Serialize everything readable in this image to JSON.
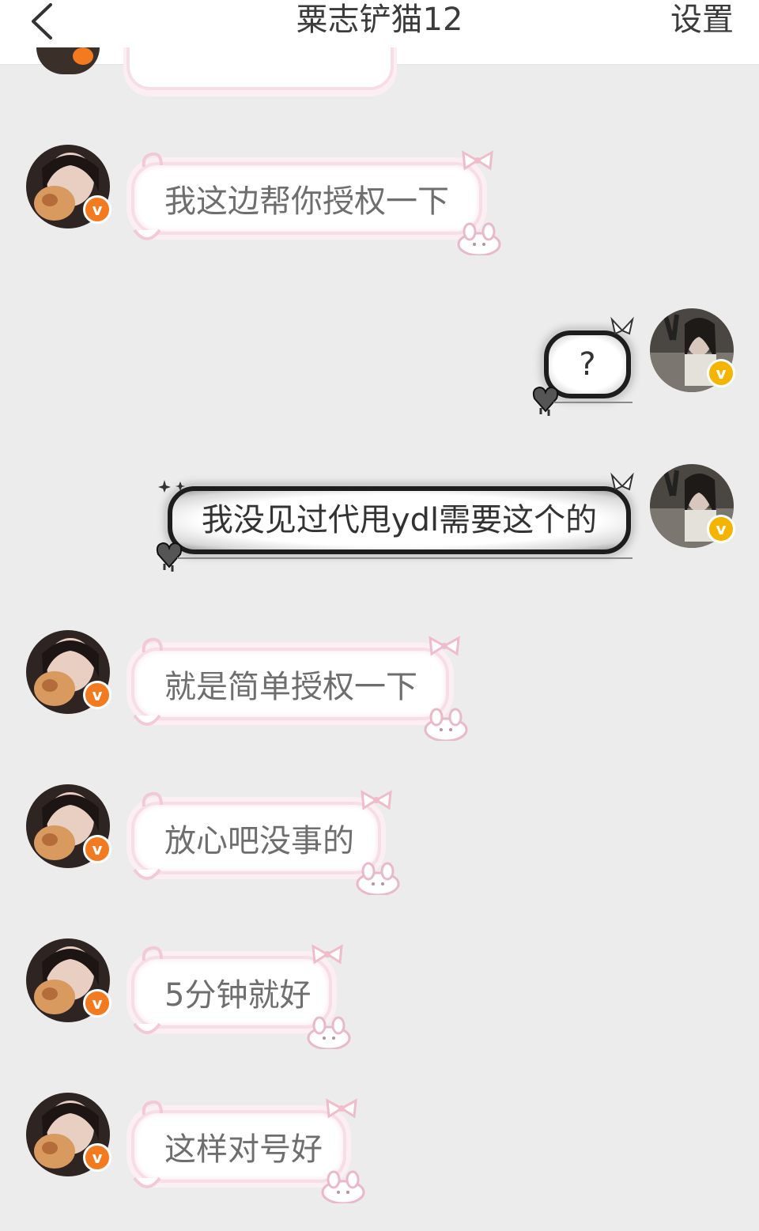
{
  "header": {
    "title": "粟志铲猫12",
    "settings_label": "设置"
  },
  "messages": [
    {
      "side": "left",
      "text": "我这边帮你授权一下"
    },
    {
      "side": "right",
      "text": "?"
    },
    {
      "side": "right",
      "text": "我没见过代甩ydl需要这个的"
    },
    {
      "side": "left",
      "text": "就是简单授权一下"
    },
    {
      "side": "left",
      "text": "放心吧没事的"
    },
    {
      "side": "left",
      "text": "5分钟就好"
    },
    {
      "side": "left",
      "text": "这样对号好"
    }
  ],
  "badges": {
    "left": "v",
    "right": "v"
  },
  "colors": {
    "background": "#ececec",
    "badge_left": "#f47a1f",
    "badge_right": "#f5b400",
    "bubble_pink_border": "#f6dde6"
  }
}
